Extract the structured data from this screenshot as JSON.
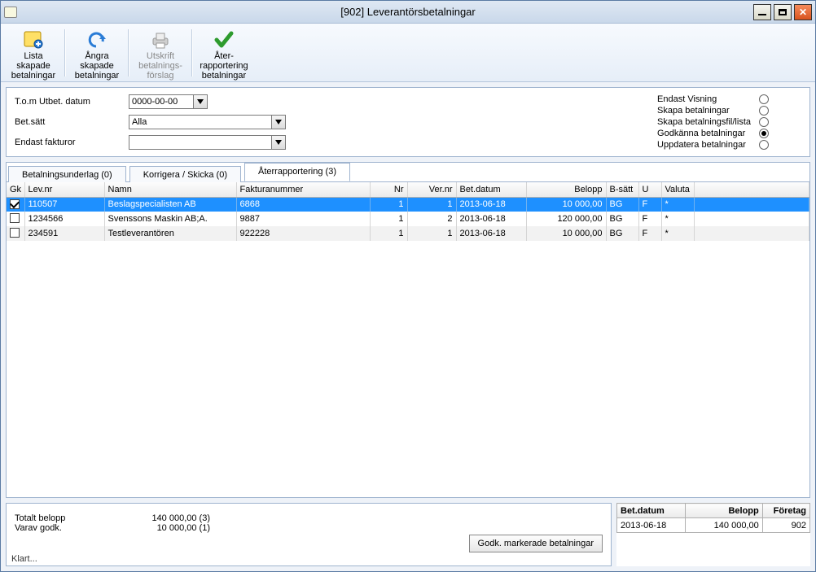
{
  "window": {
    "title": "[902]  Leverantörsbetalningar"
  },
  "toolbar": {
    "lista": "Lista\nskapade\nbetalningar",
    "angra": "Ångra\nskapade\nbetalningar",
    "utskrift": "Utskrift\nbetalnings-\nförslag",
    "ater": "Åter-\nrapportering\nbetalningar"
  },
  "filter": {
    "tom_label": "T.o.m Utbet. datum",
    "tom_value": "0000-00-00",
    "betsatt_label": "Bet.sätt",
    "betsatt_value": "Alla",
    "endast_label": "Endast fakturor",
    "endast_value": ""
  },
  "options": {
    "o1": "Endast Visning",
    "o2": "Skapa betalningar",
    "o3": "Skapa betalningsfil/lista",
    "o4": "Godkänna betalningar",
    "o5": "Uppdatera betalningar",
    "selected": "o4"
  },
  "tabs": {
    "t1": "Betalningsunderlag (0)",
    "t2": "Korrigera / Skicka (0)",
    "t3": "Återrapportering (3)"
  },
  "columns": {
    "gk": "Gk",
    "lev": "Lev.nr",
    "namn": "Namn",
    "fakt": "Fakturanummer",
    "nr": "Nr",
    "ver": "Ver.nr",
    "dat": "Bet.datum",
    "bel": "Belopp",
    "bs": "B-sätt",
    "u": "U",
    "val": "Valuta"
  },
  "rows": [
    {
      "chk": true,
      "lev": "110507",
      "namn": "Beslagspecialisten AB",
      "fakt": "6868",
      "nr": "1",
      "ver": "1",
      "dat": "2013-06-18",
      "bel": "10 000,00",
      "bs": "BG",
      "u": "F",
      "val": "*"
    },
    {
      "chk": false,
      "lev": "1234566",
      "namn": "Svenssons Maskin AB;A.",
      "fakt": "9887",
      "nr": "1",
      "ver": "2",
      "dat": "2013-06-18",
      "bel": "120 000,00",
      "bs": "BG",
      "u": "F",
      "val": "*"
    },
    {
      "chk": false,
      "lev": "234591",
      "namn": "Testleverantören",
      "fakt": "922228",
      "nr": "1",
      "ver": "1",
      "dat": "2013-06-18",
      "bel": "10 000,00",
      "bs": "BG",
      "u": "F",
      "val": "*"
    }
  ],
  "summary": {
    "total_label": "Totalt belopp",
    "total_value": "140 000,00 (3)",
    "godk_label": "Varav godk.",
    "godk_value": "10 000,00 (1)",
    "action": "Godk. markerade  betalningar"
  },
  "status": "Klart...",
  "side": {
    "col1": "Bet.datum",
    "col2": "Belopp",
    "col3": "Företag",
    "r1c1": "2013-06-18",
    "r1c2": "140 000,00",
    "r1c3": "902"
  }
}
